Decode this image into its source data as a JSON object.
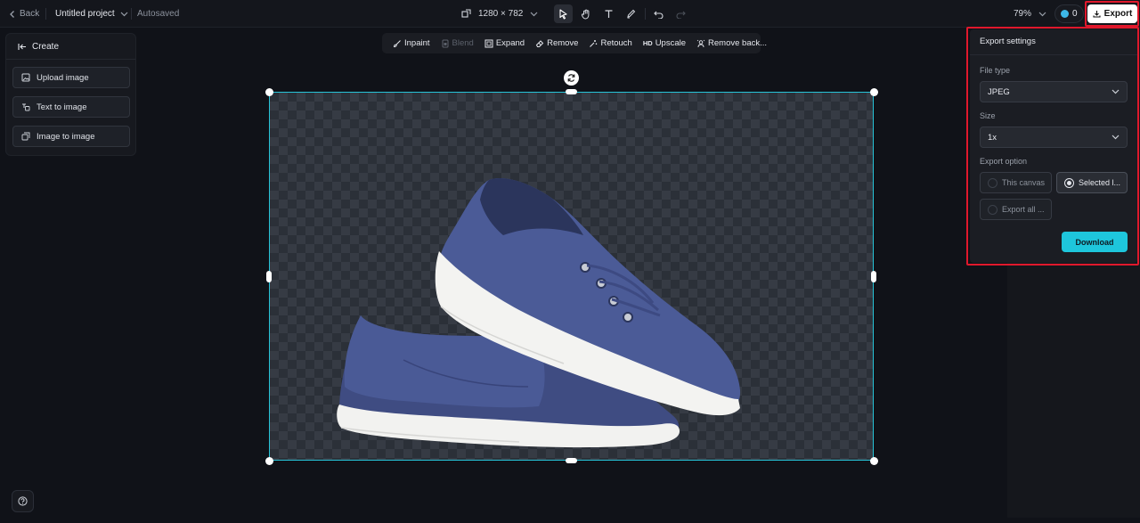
{
  "topbar": {
    "back_label": "Back",
    "project_name": "Untitled project",
    "autosaved": "Autosaved",
    "canvas_size": "1280 × 782",
    "zoom": "79%",
    "credits": "0",
    "export_label": "Export"
  },
  "create_panel": {
    "title": "Create",
    "items": [
      {
        "label": "Upload image",
        "icon": "upload-image-icon"
      },
      {
        "label": "Text to image",
        "icon": "text-to-image-icon"
      },
      {
        "label": "Image to image",
        "icon": "image-to-image-icon"
      }
    ]
  },
  "edit_toolbar": {
    "items": [
      {
        "label": "Inpaint",
        "icon": "brush-icon",
        "disabled": false
      },
      {
        "label": "Blend",
        "icon": "blend-icon",
        "disabled": true
      },
      {
        "label": "Expand",
        "icon": "expand-icon",
        "disabled": false
      },
      {
        "label": "Remove",
        "icon": "eraser-icon",
        "disabled": false
      },
      {
        "label": "Retouch",
        "icon": "retouch-icon",
        "disabled": false
      },
      {
        "label": "Upscale",
        "icon": "hd-icon",
        "disabled": false
      },
      {
        "label": "Remove back...",
        "icon": "remove-background-icon",
        "disabled": false
      }
    ],
    "hd_badge": "HD"
  },
  "export_settings": {
    "title": "Export settings",
    "file_type_label": "File type",
    "file_type_value": "JPEG",
    "size_label": "Size",
    "size_value": "1x",
    "export_option_label": "Export option",
    "options": [
      {
        "label": "This canvas",
        "selected": false
      },
      {
        "label": "Selected l...",
        "selected": true
      },
      {
        "label": "Export all ...",
        "selected": false
      }
    ],
    "download_label": "Download"
  },
  "colors": {
    "accent": "#1ec6dc",
    "selection": "#27c4d8",
    "highlight": "#e0182c",
    "shoe": "#4a5a92"
  }
}
